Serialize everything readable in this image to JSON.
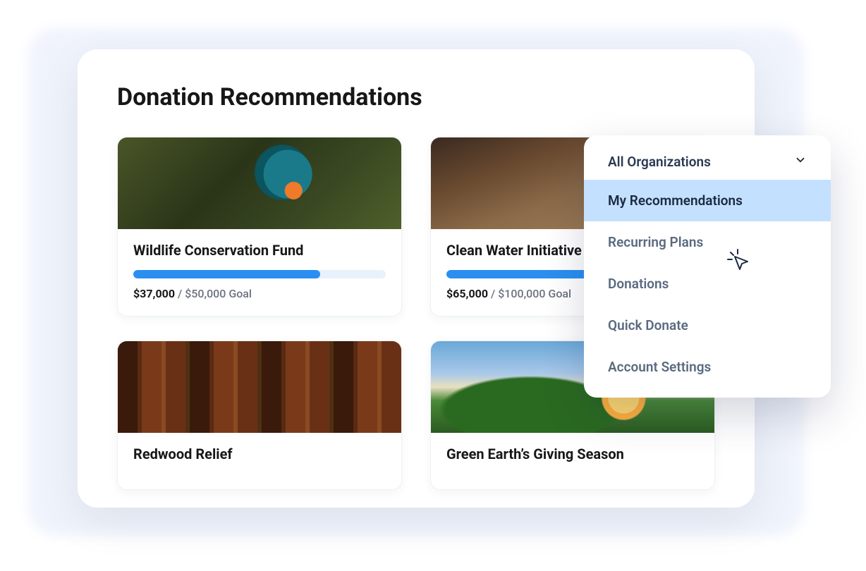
{
  "page": {
    "title": "Donation Recommendations"
  },
  "cards": [
    {
      "title": "Wildlife Conservation Fund",
      "raised": "$37,000",
      "goal_rest": " / $50,000 Goal",
      "progress_pct": 74,
      "image": "bird"
    },
    {
      "title": "Clean Water Initiative",
      "raised": "$65,000",
      "goal_rest": " / $100,000 Goal",
      "progress_pct": 65,
      "image": "water"
    },
    {
      "title": "Redwood Relief",
      "raised": "",
      "goal_rest": "",
      "progress_pct": null,
      "image": "redwood"
    },
    {
      "title": "Green Earth’s Giving Season",
      "raised": "",
      "goal_rest": "",
      "progress_pct": null,
      "image": "green"
    }
  ],
  "dropdown": {
    "header": "All Organizations",
    "items": [
      {
        "label": "My Recommendations",
        "active": true
      },
      {
        "label": "Recurring Plans",
        "active": false
      },
      {
        "label": "Donations",
        "active": false
      },
      {
        "label": "Quick Donate",
        "active": false
      },
      {
        "label": "Account Settings",
        "active": false
      }
    ]
  }
}
